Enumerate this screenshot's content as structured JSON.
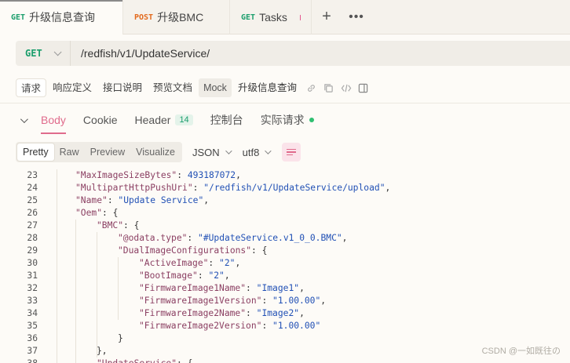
{
  "tabs": [
    {
      "method": "GET",
      "label": "升级信息查询",
      "active": true
    },
    {
      "method": "POST",
      "label": "升级BMC",
      "active": false
    },
    {
      "method": "GET",
      "label": "Tasks",
      "active": false
    }
  ],
  "request": {
    "method": "GET",
    "url": "/redfish/v1/UpdateService/"
  },
  "doc_tabs": [
    "请求",
    "响应定义",
    "接口说明",
    "预览文档",
    "Mock",
    "升级信息查询"
  ],
  "response_tabs": {
    "body": "Body",
    "cookie": "Cookie",
    "header": "Header",
    "header_count": "14",
    "console": "控制台",
    "actual": "实际请求"
  },
  "format": {
    "modes": [
      "Pretty",
      "Raw",
      "Preview",
      "Visualize"
    ],
    "type": "JSON",
    "encoding": "utf8"
  },
  "code_lines": [
    {
      "n": "23",
      "indent": 0,
      "key": "\"MaxImageSizeBytes\"",
      "value": "493187072",
      "vtype": "n",
      "tail": ","
    },
    {
      "n": "24",
      "indent": 0,
      "key": "\"MultipartHttpPushUri\"",
      "value": "\"/redfish/v1/UpdateService/upload\"",
      "vtype": "s",
      "tail": ","
    },
    {
      "n": "25",
      "indent": 0,
      "key": "\"Name\"",
      "value": "\"Update Service\"",
      "vtype": "s",
      "tail": ","
    },
    {
      "n": "26",
      "indent": 0,
      "key": "\"Oem\"",
      "value": "{",
      "vtype": "p",
      "tail": ""
    },
    {
      "n": "27",
      "indent": 1,
      "key": "\"BMC\"",
      "value": "{",
      "vtype": "p",
      "tail": ""
    },
    {
      "n": "28",
      "indent": 2,
      "key": "\"@odata.type\"",
      "value": "\"#UpdateService.v1_0_0.BMC\"",
      "vtype": "s",
      "tail": ","
    },
    {
      "n": "29",
      "indent": 2,
      "key": "\"DualImageConfigurations\"",
      "value": "{",
      "vtype": "p",
      "tail": ""
    },
    {
      "n": "30",
      "indent": 3,
      "key": "\"ActiveImage\"",
      "value": "\"2\"",
      "vtype": "s",
      "tail": ","
    },
    {
      "n": "31",
      "indent": 3,
      "key": "\"BootImage\"",
      "value": "\"2\"",
      "vtype": "s",
      "tail": ","
    },
    {
      "n": "32",
      "indent": 3,
      "key": "\"FirmwareImage1Name\"",
      "value": "\"Image1\"",
      "vtype": "s",
      "tail": ","
    },
    {
      "n": "33",
      "indent": 3,
      "key": "\"FirmwareImage1Version\"",
      "value": "\"1.00.00\"",
      "vtype": "s",
      "tail": ","
    },
    {
      "n": "34",
      "indent": 3,
      "key": "\"FirmwareImage2Name\"",
      "value": "\"Image2\"",
      "vtype": "s",
      "tail": ","
    },
    {
      "n": "35",
      "indent": 3,
      "key": "\"FirmwareImage2Version\"",
      "value": "\"1.00.00\"",
      "vtype": "s",
      "tail": ""
    },
    {
      "n": "36",
      "indent": 2,
      "key": "",
      "value": "}",
      "vtype": "p",
      "tail": ""
    },
    {
      "n": "37",
      "indent": 1,
      "key": "",
      "value": "},",
      "vtype": "p",
      "tail": ""
    },
    {
      "n": "38",
      "indent": 1,
      "key": "\"UpdateService\"",
      "value": "{",
      "vtype": "p",
      "tail": ""
    }
  ],
  "watermark": "CSDN @一如既往の"
}
